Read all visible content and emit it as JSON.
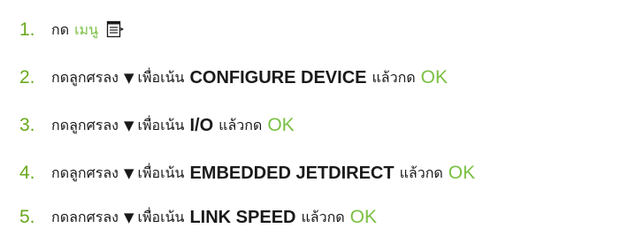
{
  "steps": [
    {
      "number": "1.",
      "press": "กด",
      "menu": "เมนู",
      "icon": "menu-icon"
    },
    {
      "number": "2.",
      "press_arrow": "กดลูกศรลง",
      "arrow": "▼",
      "highlight": "เพื่อเน้น",
      "item": "CONFIGURE DEVICE",
      "then_press": "แล้วกด",
      "ok": "OK"
    },
    {
      "number": "3.",
      "press_arrow": "กดลูกศรลง",
      "arrow": "▼",
      "highlight": "เพื่อเน้น",
      "item": "I/O",
      "then_press": "แล้วกด",
      "ok": "OK"
    },
    {
      "number": "4.",
      "press_arrow": "กดลูกศรลง",
      "arrow": "▼",
      "highlight": "เพื่อเน้น",
      "item": "EMBEDDED JETDIRECT",
      "then_press": "แล้วกด",
      "ok": "OK"
    },
    {
      "number": "5.",
      "press_arrow": "กดลกศรลง",
      "arrow": "▼",
      "highlight": "เพื่อเน้น",
      "item": "LINK SPEED",
      "then_press": "แล้วกด",
      "ok": "OK"
    }
  ],
  "colors": {
    "accent_green": "#7ac043",
    "number_green": "#6aa81c",
    "text": "#1a1a1a"
  }
}
